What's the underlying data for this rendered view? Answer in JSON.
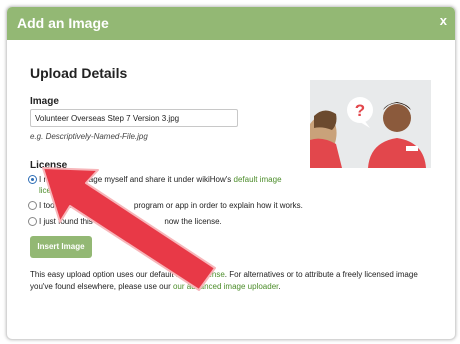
{
  "dialog": {
    "title": "Add an Image",
    "close": "x"
  },
  "upload": {
    "heading": "Upload Details",
    "image_label": "Image",
    "image_value": "Volunteer Overseas Step 7 Version 3.jpg",
    "hint": "e.g. Descriptively-Named-File.jpg"
  },
  "license": {
    "label": "License",
    "options": [
      {
        "text": "I made this image myself and share it under wikiHow's ",
        "link": "default image license",
        "suffix": ".",
        "selected": true
      },
      {
        "text": "I took a so",
        "text_after": "program or app in order to explain how it works.",
        "selected": false
      },
      {
        "text": "I just found this online",
        "text_after": "now the license.",
        "selected": false
      }
    ]
  },
  "insert_button": "Insert Image",
  "footer": {
    "part1": "This easy upload option uses our default ",
    "link1": "image license",
    "part2": ". For alternatives or to attribute a freely licensed image you've found elsewhere, please use our ",
    "link2": "our advanced image uploader",
    "part3": "."
  },
  "colors": {
    "header": "#93b874",
    "link": "#4c8d2a",
    "arrow": "#e83947",
    "radio_selected": "#2d6db5"
  },
  "icons": {
    "close": "close-icon",
    "annotation": "arrow-annotation"
  }
}
